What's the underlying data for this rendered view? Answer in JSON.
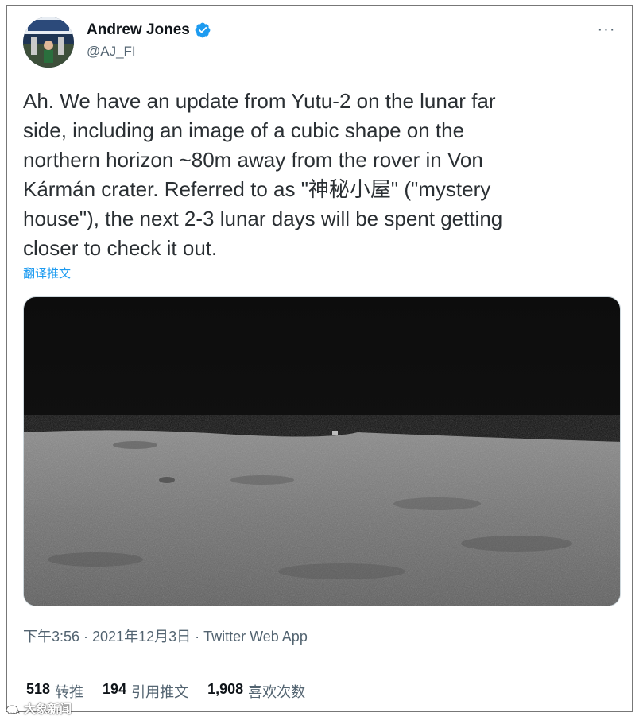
{
  "author": {
    "name": "Andrew Jones",
    "handle": "@AJ_FI",
    "verified": true,
    "avatar_icon": "avatar-image",
    "verified_color": "#1d9bf0"
  },
  "tweet": {
    "text": "Ah. We have an update from Yutu-2 on the lunar far\nside, including an image of a cubic shape on the\nnorthern horizon ~80m away from the rover in Von\nKármán crater. Referred to as \"神秘小屋\" (\"mystery\nhouse\"), the next 2-3 lunar days will be spent getting\ncloser to check it out.",
    "translate_label": "翻译推文",
    "media_description_icon": "lunar-horizon-photo"
  },
  "meta": {
    "timestamp": "下午3:56 · 2021年12月3日 · Twitter Web App"
  },
  "stats": [
    {
      "count": "518",
      "label": "转推"
    },
    {
      "count": "194",
      "label": "引用推文"
    },
    {
      "count": "1,908",
      "label": "喜欢次数"
    }
  ],
  "more_label": "···",
  "watermark": {
    "text": "大象新闻"
  },
  "colors": {
    "link": "#1d9bf0",
    "secondary_text": "#536471",
    "primary_text": "#0f1419"
  }
}
